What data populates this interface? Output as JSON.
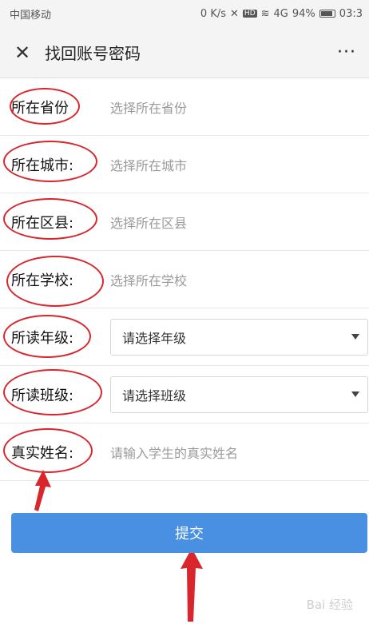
{
  "statusbar": {
    "carrier": "中国移动",
    "speed": "0 K/s",
    "signal": "4G",
    "battery": "94%",
    "time": "03:3"
  },
  "navbar": {
    "title": "找回账号密码",
    "more": "···"
  },
  "form": {
    "province": {
      "label": "所在省份",
      "placeholder": "选择所在省份"
    },
    "city": {
      "label": "所在城市:",
      "placeholder": "选择所在城市"
    },
    "district": {
      "label": "所在区县:",
      "placeholder": "选择所在区县"
    },
    "school": {
      "label": "所在学校:",
      "placeholder": "选择所在学校"
    },
    "grade": {
      "label": "所读年级:",
      "value": "请选择年级"
    },
    "class": {
      "label": "所读班级:",
      "value": "请选择班级"
    },
    "name": {
      "label": "真实姓名:",
      "placeholder": "请输入学生的真实姓名"
    }
  },
  "submit_label": "提交",
  "watermark": "Bai 经验",
  "colors": {
    "accent": "#4a90e2",
    "annotation": "#d8262c"
  }
}
